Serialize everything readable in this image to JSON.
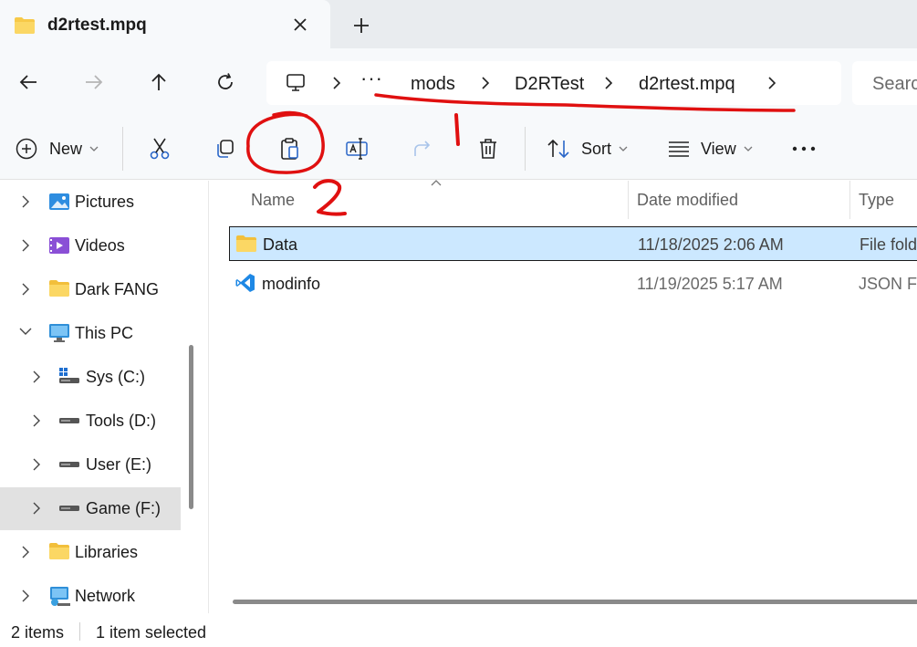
{
  "tab": {
    "title": "d2rtest.mpq",
    "close_icon": "close-icon",
    "new_tab_icon": "plus-icon"
  },
  "nav": {
    "back": "back-arrow-icon",
    "forward": "forward-arrow-icon",
    "up": "up-arrow-icon",
    "refresh": "refresh-icon"
  },
  "address": {
    "ellipsis": "···",
    "crumbs": [
      "mods",
      "D2RTest",
      "d2rtest.mpq"
    ]
  },
  "search": {
    "placeholder": "Search"
  },
  "commands": {
    "new_label": "New",
    "sort_label": "Sort",
    "view_label": "View",
    "more": "···"
  },
  "navpane": {
    "items": [
      {
        "label": "Pictures"
      },
      {
        "label": "Videos"
      },
      {
        "label": "Dark FANG"
      },
      {
        "label": "This PC"
      },
      {
        "label": "Sys (C:)"
      },
      {
        "label": "Tools (D:)"
      },
      {
        "label": "User (E:)"
      },
      {
        "label": "Game (F:)"
      },
      {
        "label": "Libraries"
      },
      {
        "label": "Network"
      }
    ]
  },
  "columns": {
    "name": "Name",
    "date": "Date modified",
    "type": "Type"
  },
  "files": [
    {
      "name": "Data",
      "date": "11/18/2025 2:06 AM",
      "type": "File fold"
    },
    {
      "name": "modinfo",
      "date": "11/19/2025 5:17 AM",
      "type": "JSON Fil"
    }
  ],
  "status": {
    "count": "2 items",
    "selected": "1 item selected"
  },
  "annotations": {
    "one": "1",
    "two": "2",
    "color": "#e01010"
  },
  "colors": {
    "selection": "#cce8ff",
    "folder": "#f7c948",
    "vscode": "#1e88e5"
  }
}
